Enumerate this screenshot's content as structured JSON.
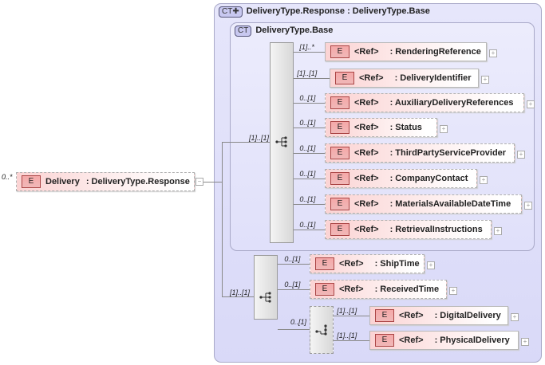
{
  "root": {
    "multiplicity": "0..*",
    "badge": "E",
    "name": "Delivery",
    "type": ": DeliveryType.Response",
    "collapse": "−"
  },
  "outer_type": {
    "badge": "CT✚",
    "title": "DeliveryType.Response : DeliveryType.Base"
  },
  "inner_type": {
    "badge": "CT",
    "title": "DeliveryType.Base"
  },
  "inner_sequence": {
    "multiplicity": "[1]..[1]",
    "elements": [
      {
        "multiplicity": "[1]..*",
        "badge": "E",
        "ref": "<Ref>",
        "name": ": RenderingReference",
        "optional": false
      },
      {
        "multiplicity": "[1]..[1]",
        "badge": "E",
        "ref": "<Ref>",
        "name": ": DeliveryIdentifier",
        "optional": false
      },
      {
        "multiplicity": "0..[1]",
        "badge": "E",
        "ref": "<Ref>",
        "name": ": AuxiliaryDeliveryReferences",
        "optional": true
      },
      {
        "multiplicity": "0..[1]",
        "badge": "E",
        "ref": "<Ref>",
        "name": ": Status",
        "optional": true
      },
      {
        "multiplicity": "0..[1]",
        "badge": "E",
        "ref": "<Ref>",
        "name": ": ThirdPartyServiceProvider",
        "optional": true
      },
      {
        "multiplicity": "0..[1]",
        "badge": "E",
        "ref": "<Ref>",
        "name": ": CompanyContact",
        "optional": true
      },
      {
        "multiplicity": "0..[1]",
        "badge": "E",
        "ref": "<Ref>",
        "name": ": MaterialsAvailableDateTime",
        "optional": true
      },
      {
        "multiplicity": "0..[1]",
        "badge": "E",
        "ref": "<Ref>",
        "name": ": RetrievalInstructions",
        "optional": true
      }
    ]
  },
  "outer_sequence": {
    "multiplicity": "[1]..[1]",
    "elements": [
      {
        "multiplicity": "0..[1]",
        "badge": "E",
        "ref": "<Ref>",
        "name": ": ShipTime",
        "optional": true
      },
      {
        "multiplicity": "0..[1]",
        "badge": "E",
        "ref": "<Ref>",
        "name": ": ReceivedTime",
        "optional": true
      }
    ],
    "choice": {
      "multiplicity": "0..[1]",
      "elements": [
        {
          "multiplicity": "[1]..[1]",
          "badge": "E",
          "ref": "<Ref>",
          "name": ": DigitalDelivery",
          "optional": false
        },
        {
          "multiplicity": "[1]..[1]",
          "badge": "E",
          "ref": "<Ref>",
          "name": ": PhysicalDelivery",
          "optional": false
        }
      ]
    }
  },
  "expand_symbol": "+"
}
